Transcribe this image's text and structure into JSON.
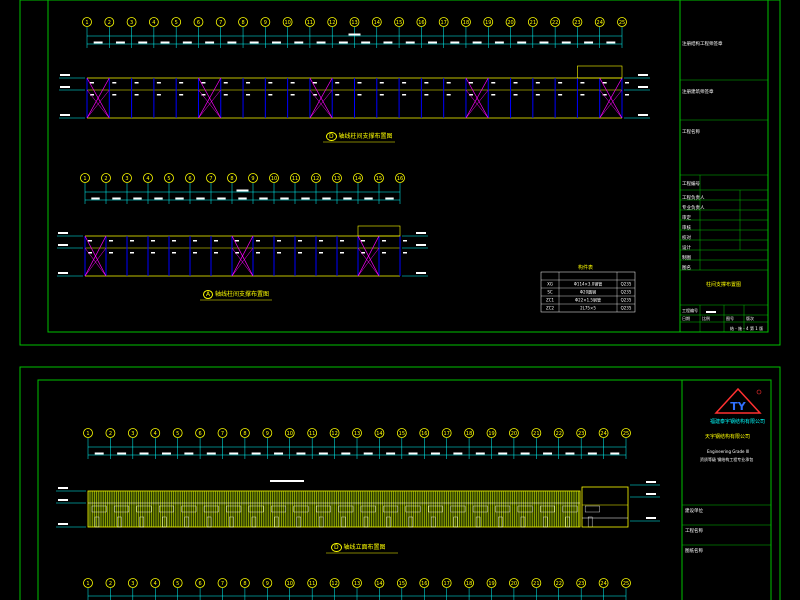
{
  "sheet1": {
    "elevation_top": {
      "axis_labels": [
        "1",
        "2",
        "3",
        "4",
        "5",
        "6",
        "7",
        "8",
        "9",
        "10",
        "11",
        "12",
        "13",
        "14",
        "15",
        "16",
        "17",
        "18",
        "19",
        "20",
        "21",
        "22",
        "23",
        "24",
        "25"
      ],
      "caption_tag": "D",
      "caption": "轴线柱间支撑布置图"
    },
    "elevation_bottom": {
      "axis_labels": [
        "1",
        "2",
        "3",
        "4",
        "5",
        "6",
        "7",
        "8",
        "9",
        "10",
        "11",
        "12",
        "13",
        "14",
        "15",
        "16"
      ],
      "caption_tag": "A",
      "caption": "轴线柱间支撑布置图"
    },
    "member_table": {
      "title": "构件表",
      "rows": [
        [
          "XG",
          "Φ114×3.0钢管",
          "Q235"
        ],
        [
          "SC",
          "Φ20圆钢",
          "Q235"
        ],
        [
          "ZC1",
          "Φ22×1.5钢管",
          "Q235"
        ],
        [
          "ZC2",
          "2L75×5",
          "Q235"
        ]
      ]
    },
    "title_block": {
      "rows": [
        "注册结构工程师签章",
        "注册建筑师签章",
        "工程名称",
        "工程编号",
        "工程负责人",
        "专业负责人",
        "审定",
        "审核",
        "校对",
        "设计",
        "制图",
        "图名"
      ],
      "drawing_name": "柱间支撑布置图",
      "scale_label": "工程编号",
      "footer_labels": [
        "日期",
        "比例",
        "图号",
        "版次"
      ],
      "footer_values": [
        "",
        "",
        "结 - 施 - 4",
        "第 1 版"
      ]
    }
  },
  "sheet2": {
    "elevation": {
      "axis_labels": [
        "1",
        "2",
        "3",
        "4",
        "5",
        "6",
        "7",
        "8",
        "9",
        "10",
        "11",
        "12",
        "13",
        "14",
        "15",
        "16",
        "17",
        "18",
        "19",
        "20",
        "21",
        "22",
        "23",
        "24",
        "25"
      ],
      "caption_tag": "D",
      "caption": "轴线立面布置图"
    },
    "title_block": {
      "company_cn": "福建泰宇钢结构有限公司",
      "company_line2": "天宇钢结构有限公司",
      "company_en": "Engineering Grade III",
      "cert": "资质等级 钢结构工程专业承包",
      "rows": [
        "建设单位",
        "工程名称",
        "图纸名称"
      ]
    },
    "bottom_axis_labels": [
      "1",
      "2",
      "3",
      "4",
      "5",
      "6",
      "7",
      "8",
      "9",
      "10",
      "11",
      "12",
      "13",
      "14",
      "15",
      "16",
      "17",
      "18",
      "19",
      "20",
      "21",
      "22",
      "23",
      "24",
      "25"
    ]
  },
  "colors": {
    "background": "#000000",
    "frame": "#00c000",
    "axis_bubble": "#ffff00",
    "dimension": "#00ffff",
    "bracing": "#ff00ff",
    "column": "#0000ff",
    "beam": "#ffff00",
    "text": "#ffffff",
    "cladding": "#ffff00"
  }
}
